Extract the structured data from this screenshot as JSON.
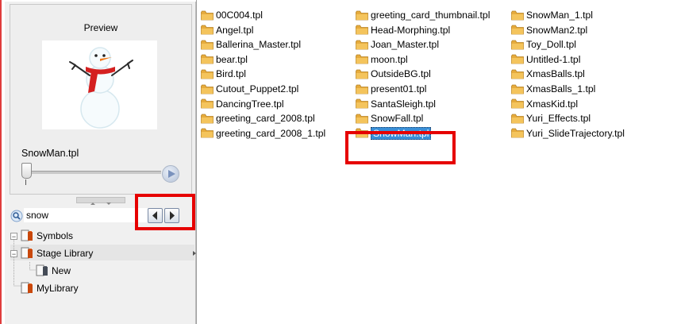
{
  "preview": {
    "title": "Preview",
    "file_name": "SnowMan.tpl"
  },
  "search": {
    "value": "snow",
    "prev_label": "◀",
    "next_label": "▶"
  },
  "tree": {
    "items": [
      {
        "label": "Symbols"
      },
      {
        "label": "Stage Library"
      },
      {
        "label": "New"
      },
      {
        "label": "MyLibrary"
      }
    ]
  },
  "files": {
    "columns": [
      [
        "00C004.tpl",
        "Angel.tpl",
        "Ballerina_Master.tpl",
        "bear.tpl",
        "Bird.tpl",
        "Cutout_Puppet2.tpl",
        "DancingTree.tpl",
        "greeting_card_2008.tpl",
        "greeting_card_2008_1.tpl"
      ],
      [
        "greeting_card_thumbnail.tpl",
        "Head-Morphing.tpl",
        "Joan_Master.tpl",
        "moon.tpl",
        "OutsideBG.tpl",
        "present01.tpl",
        "SantaSleigh.tpl",
        "SnowFall.tpl",
        "SnowMan.tpl"
      ],
      [
        "SnowMan_1.tpl",
        "SnowMan2.tpl",
        "Toy_Doll.tpl",
        "Untitled-1.tpl",
        "XmasBalls.tpl",
        "XmasBalls_1.tpl",
        "XmasKid.tpl",
        "Yuri_Effects.tpl",
        "Yuri_SlideTrajectory.tpl"
      ]
    ],
    "selected": "SnowMan.tpl"
  },
  "colors": {
    "highlight": "#e60000",
    "selection": "#3a90d8",
    "folder": "#f4c45c"
  },
  "icons": [
    "search-icon",
    "folder-icon",
    "library-icon",
    "play-icon",
    "prev-arrow-icon",
    "next-arrow-icon"
  ]
}
